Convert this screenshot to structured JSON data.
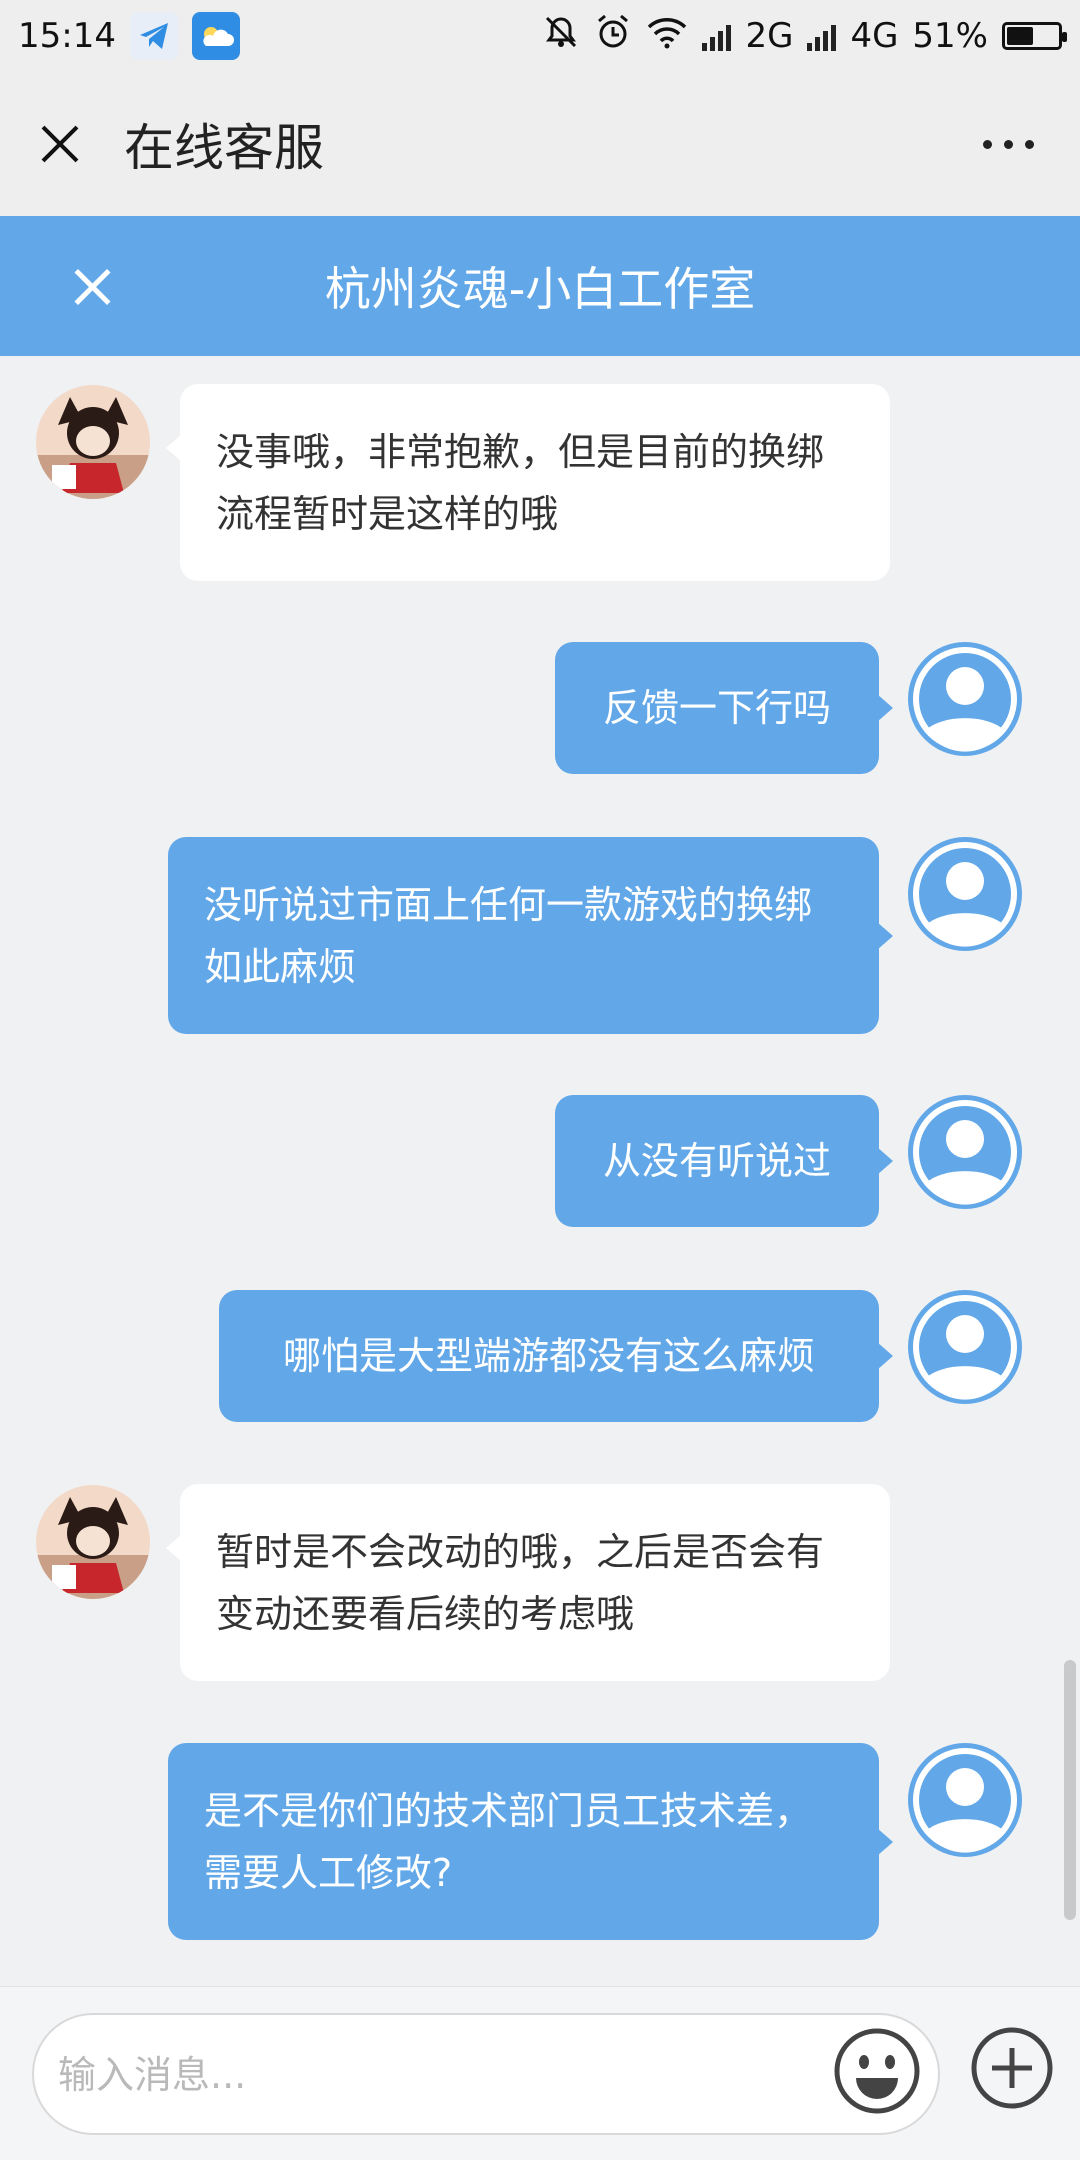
{
  "status_bar": {
    "time": "15:14",
    "network_1": "2G",
    "network_2": "4G",
    "battery_percent": "51%",
    "battery_level": 0.51,
    "icons": [
      "telegram-app-icon",
      "weather-app-icon",
      "mute-icon",
      "alarm-icon",
      "wifi-icon",
      "signal-icon",
      "battery-icon"
    ]
  },
  "header": {
    "title": "在线客服",
    "close_icon": "close-icon",
    "more_icon": "more-icon"
  },
  "banner": {
    "title": "杭州炎魂-小白工作室",
    "close_icon": "close-icon"
  },
  "messages": [
    {
      "from": "agent",
      "text": "没事哦，非常抱歉，但是目前的换绑流程暂时是这样的哦"
    },
    {
      "from": "user",
      "text": "反馈一下行吗"
    },
    {
      "from": "user",
      "text": "没听说过市面上任何一款游戏的换绑如此麻烦"
    },
    {
      "from": "user",
      "text": "从没有听说过"
    },
    {
      "from": "user",
      "text": "哪怕是大型端游都没有这么麻烦"
    },
    {
      "from": "agent",
      "text": "暂时是不会改动的哦，之后是否会有变动还要看后续的考虑哦"
    },
    {
      "from": "user",
      "text": "是不是你们的技术部门员工技术差，需要人工修改?"
    }
  ],
  "input": {
    "placeholder": "输入消息...",
    "value": ""
  },
  "colors": {
    "accent": "#62a8e8",
    "background": "#f0f1f3",
    "agent_bubble": "#ffffff"
  }
}
